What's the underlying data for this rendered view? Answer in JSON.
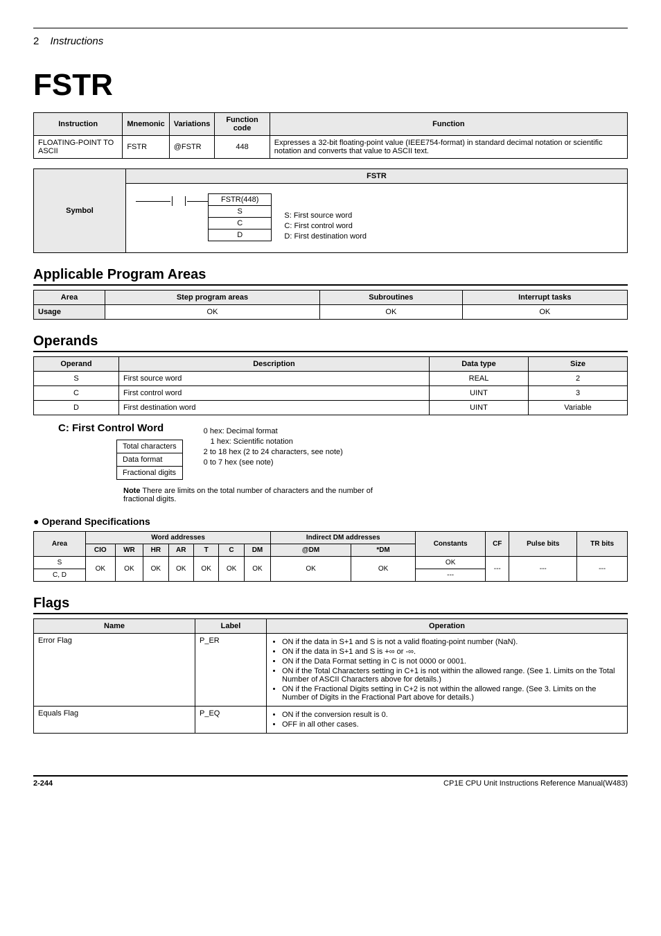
{
  "chapter": {
    "num": "2",
    "title": "Instructions"
  },
  "title": "FSTR",
  "summary": {
    "headers": [
      "Instruction",
      "Mnemonic",
      "Variations",
      "Function code",
      "Function"
    ],
    "row": {
      "instruction": "FLOATING-POINT TO ASCII",
      "mnemonic": "FSTR",
      "variations": "@FSTR",
      "code": "448",
      "function": "Expresses a 32-bit floating-point value (IEEE754-format) in standard decimal notation or scientific notation and converts that value to ASCII text."
    }
  },
  "symbol": {
    "label": "Symbol",
    "title": "FSTR",
    "box": [
      "FSTR(448)",
      "S",
      "C",
      "D"
    ],
    "desc": {
      "s": "S: First source word",
      "c": "C: First control word",
      "d": "D: First destination word"
    }
  },
  "areas": {
    "title": "Applicable Program Areas",
    "headers": [
      "Area",
      "Step program areas",
      "Subroutines",
      "Interrupt tasks"
    ],
    "row": {
      "label": "Usage",
      "v1": "OK",
      "v2": "OK",
      "v3": "OK"
    }
  },
  "operands": {
    "title": "Operands",
    "headers": [
      "Operand",
      "Description",
      "Data type",
      "Size"
    ],
    "rows": [
      {
        "o": "S",
        "d": "First source word",
        "t": "REAL",
        "s": "2"
      },
      {
        "o": "C",
        "d": "First control word",
        "t": "UINT",
        "s": "3"
      },
      {
        "o": "D",
        "d": "First destination word",
        "t": "UINT",
        "s": "Variable"
      }
    ]
  },
  "ctrl": {
    "title": "C: First Control Word",
    "left": [
      "Total characters",
      "Data format",
      "Fractional digits"
    ],
    "right": [
      "0 hex: Decimal format",
      "1 hex: Scientific notation",
      "2 to 18 hex (2 to 24 characters, see note)",
      "0 to 7 hex (see note)"
    ],
    "note_label": "Note",
    "note": "There are limits on the total number of characters and the number of fractional digits."
  },
  "opspec": {
    "title": "Operand Specifications",
    "top": [
      "Area",
      "Word addresses",
      "Indirect DM addresses",
      "Constants",
      "CF",
      "Pulse bits",
      "TR bits"
    ],
    "sub": [
      "CIO",
      "WR",
      "HR",
      "AR",
      "T",
      "C",
      "DM",
      "@DM",
      "*DM"
    ],
    "rows": [
      {
        "area": "S",
        "vals": [
          "OK",
          "OK",
          "OK",
          "OK",
          "OK",
          "OK",
          "OK",
          "OK",
          "OK"
        ],
        "const": "OK",
        "cf": "---",
        "pb": "---",
        "tr": "---"
      },
      {
        "area": "C, D",
        "const": "---"
      }
    ]
  },
  "flags": {
    "title": "Flags",
    "headers": [
      "Name",
      "Label",
      "Operation"
    ],
    "rows": [
      {
        "name": "Error Flag",
        "label": "P_ER",
        "ops": [
          "ON if the data in S+1 and S is not a valid floating-point number (NaN).",
          "ON if the data in S+1 and S is +∞ or -∞.",
          "ON if the Data Format setting in C is not 0000 or 0001.",
          "ON if the Total Characters setting in C+1 is not within the allowed range. (See 1. Limits on the Total Number of ASCII Characters above for details.)",
          "ON if the Fractional Digits setting in C+2 is not within the allowed range. (See 3. Limits on the Number of Digits in the Fractional Part above for details.)"
        ]
      },
      {
        "name": "Equals Flag",
        "label": "P_EQ",
        "ops": [
          "ON if the conversion result is 0.",
          "OFF in all other cases."
        ]
      }
    ]
  },
  "footer": {
    "page": "2-244",
    "manual": "CP1E CPU Unit Instructions Reference Manual(W483)"
  }
}
